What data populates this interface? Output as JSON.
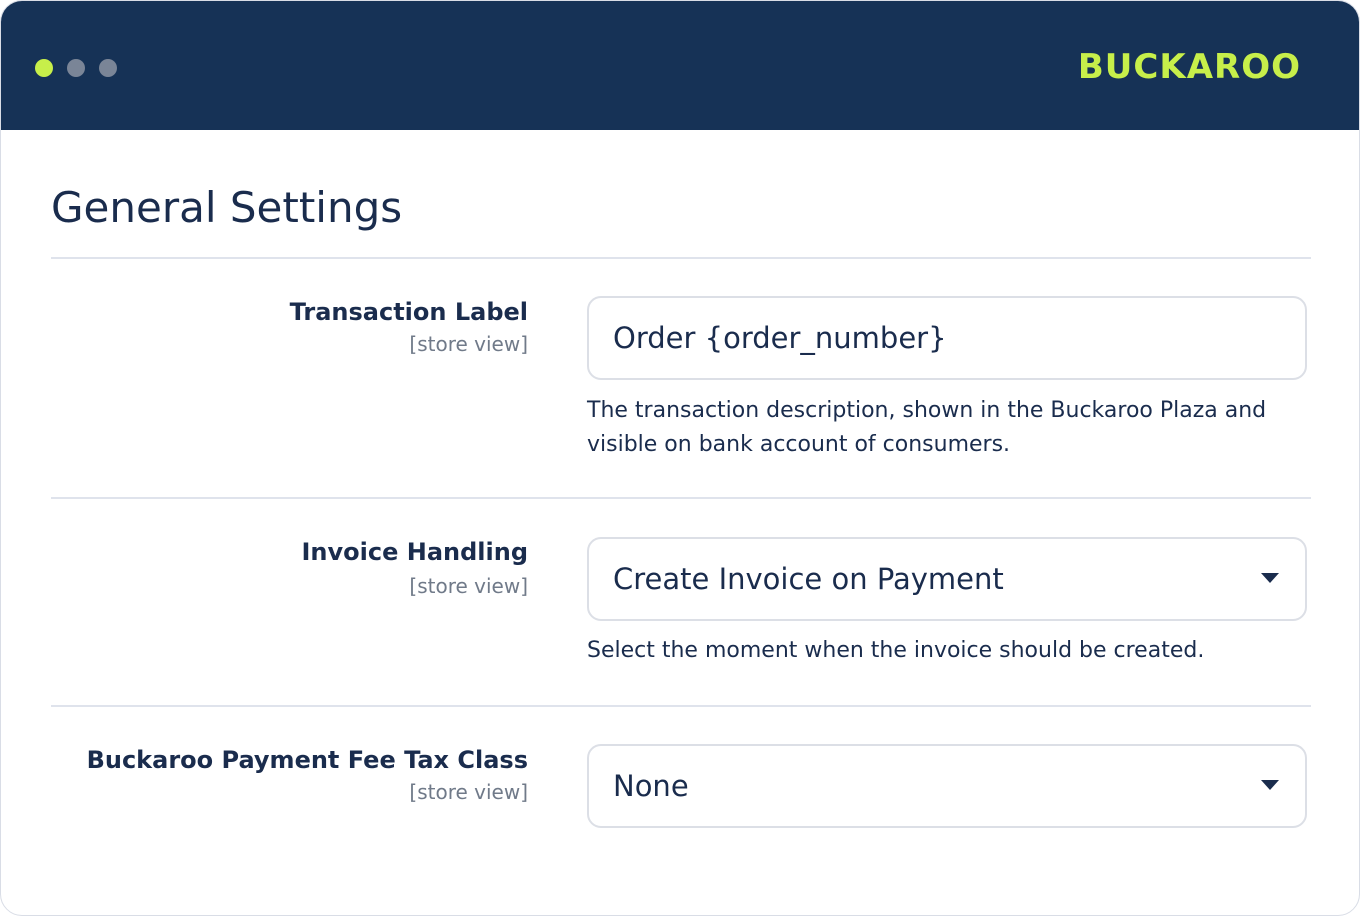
{
  "window": {
    "controls": [
      {
        "name": "window-dot-green",
        "color": "#c7ef4a"
      },
      {
        "name": "window-dot-gray-1",
        "color": "#7a8597"
      },
      {
        "name": "window-dot-gray-2",
        "color": "#7a8597"
      }
    ]
  },
  "brand": {
    "logo_text": "BUCKAROO",
    "color": "#c7ef4a",
    "header_bg": "#163256"
  },
  "page": {
    "title": "General Settings"
  },
  "colors": {
    "text_primary": "#1a2c4d",
    "text_muted": "#707a89",
    "border": "#dcdfe6"
  },
  "settings": [
    {
      "label": "Transaction Label",
      "scope": "[store view]",
      "control": "text",
      "value": "Order {order_number}",
      "help": "The transaction description, shown in the Buckaroo Plaza and visible on bank account of consumers."
    },
    {
      "label": "Invoice Handling",
      "scope": "[store view]",
      "control": "select",
      "value": "Create Invoice on Payment",
      "help": "Select the moment when the invoice should be created."
    },
    {
      "label": "Buckaroo Payment Fee Tax Class",
      "scope": "[store view]",
      "control": "select",
      "value": "None",
      "help": ""
    }
  ]
}
